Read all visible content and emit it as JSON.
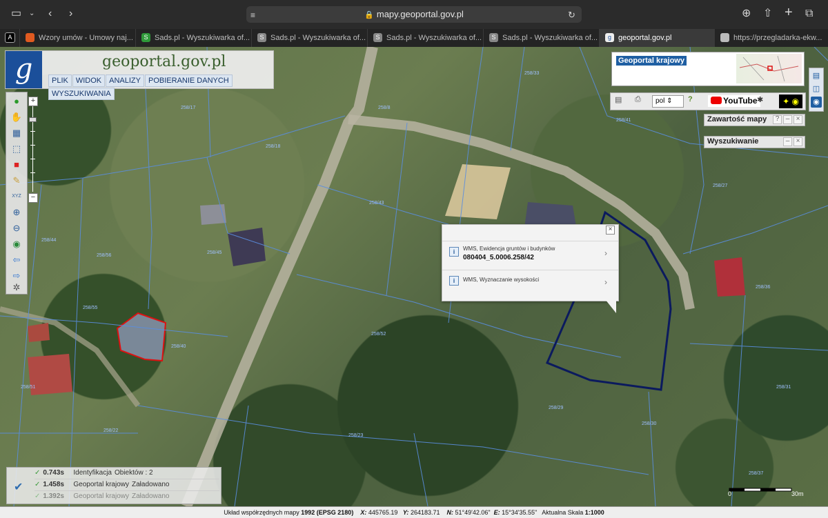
{
  "browser": {
    "url": "mapy.geoportal.gov.pl",
    "tabs": [
      {
        "label": "Wzory umów - Umowy naj..."
      },
      {
        "label": "Sads.pl - Wyszukiwarka of..."
      },
      {
        "label": "Sads.pl - Wyszukiwarka of..."
      },
      {
        "label": "Sads.pl - Wyszukiwarka of..."
      },
      {
        "label": "Sads.pl - Wyszukiwarka of..."
      },
      {
        "label": "geoportal.gov.pl"
      },
      {
        "label": "https://przegladarka-ekw..."
      }
    ],
    "active_tab": 5
  },
  "app": {
    "logo_letter": "g",
    "title": "geoportal.gov.pl",
    "menu": [
      "PLIK",
      "WIDOK",
      "ANALIZY",
      "POBIERANIE DANYCH",
      "WYSZUKIWANIA"
    ]
  },
  "right": {
    "minimap_title": "Geoportal krajowy",
    "language": "pol",
    "youtube": "YouTube",
    "panel_contents": "Zawartość mapy",
    "panel_search": "Wyszukiwanie"
  },
  "popup": {
    "row1_layer": "WMS, Ewidencja gruntów i budynków",
    "row1_value": "080404_5.0006.258/42",
    "row2_layer": "WMS, Wyznaczanie wysokości"
  },
  "log": [
    {
      "time": "0.743s",
      "name": "Identyfikacja",
      "status": "Obiektów : 2"
    },
    {
      "time": "1.458s",
      "name": "Geoportal krajowy",
      "status": "Załadowano"
    },
    {
      "time": "1.392s",
      "name": "Geoportal krajowy",
      "status": "Załadowano"
    }
  ],
  "scale": {
    "start": "0",
    "end": "30m"
  },
  "status": {
    "crs_label": "Układ współrzędnych mapy",
    "crs_value": "1992 (EPSG 2180)",
    "x_label": "X:",
    "x": "445765.19",
    "y_label": "Y:",
    "y": "264183.71",
    "n_label": "N:",
    "n": "51°49'42.06\"",
    "e_label": "E:",
    "e": "15°34'35.55\"",
    "scale_label": "Aktualna Skala",
    "scale_value": "1:1000"
  },
  "parcel_labels": [
    "258/17",
    "258/18",
    "258/8",
    "258/43",
    "258/45",
    "258/44",
    "258/56",
    "258/55",
    "258/52",
    "258/40",
    "258/51",
    "258/22",
    "258/23",
    "258/29",
    "258/30",
    "258/36",
    "258/27",
    "258/31",
    "258/41",
    "258/33",
    "258/37"
  ],
  "colors": {
    "accent": "#1f5fa3",
    "parcel_outline": "#0b1a5e",
    "building": "#d11"
  }
}
